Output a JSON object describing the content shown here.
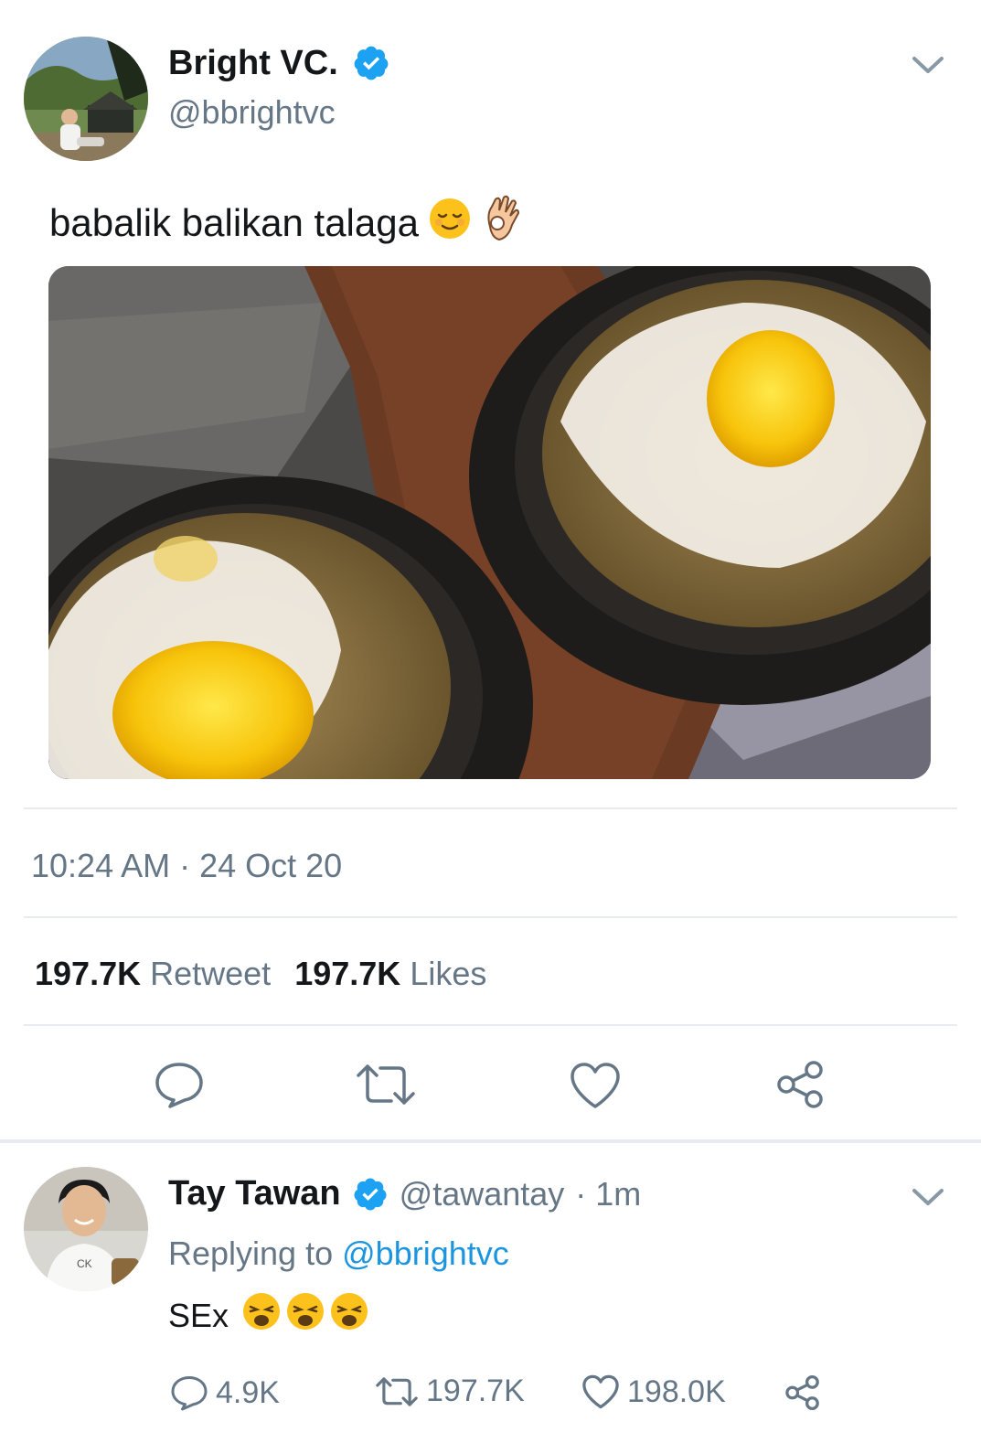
{
  "tweet": {
    "author": {
      "name": "Bright VC.",
      "handle": "@bbrightvc"
    },
    "text": "babalik balikan talaga",
    "text_emojis": [
      "relieved-face-emoji",
      "ok-hand-emoji"
    ],
    "timestamp": "10:24 AM · 24 Oct 20",
    "stats": {
      "retweet_count": "197.7K",
      "retweet_label": "Retweet",
      "likes_count": "197.7K",
      "likes_label": "Likes"
    },
    "actions": [
      "reply-icon",
      "retweet-icon",
      "like-icon",
      "share-icon"
    ]
  },
  "reply": {
    "author": {
      "name": "Tay Tawan",
      "handle": "@tawantay",
      "time": "· 1m"
    },
    "replying_prefix": "Replying to",
    "replying_to": "@bbrightvc",
    "text": "SEx",
    "text_emojis": [
      "weary-face-emoji",
      "weary-face-emoji",
      "weary-face-emoji"
    ],
    "counts": {
      "replies": "4.9K",
      "retweets": "197.7K",
      "likes": "198.0K"
    }
  },
  "colors": {
    "verified": "#1da1f2",
    "secondary_text": "#657786",
    "link": "#1b95e0",
    "divider": "#e6ecf0"
  }
}
